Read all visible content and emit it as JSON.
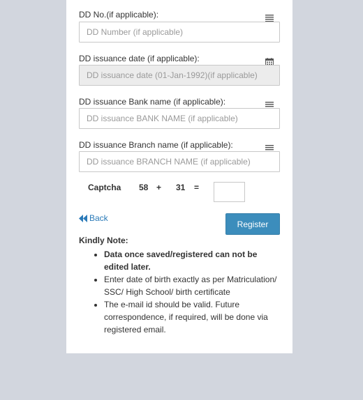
{
  "form": {
    "dd_no": {
      "label": "DD No.(if applicable):",
      "placeholder": "DD Number (if applicable)",
      "icon": "list-icon"
    },
    "dd_date": {
      "label": "DD issuance date (if applicable):",
      "placeholder": "DD issuance date (01-Jan-1992)(if applicable)",
      "icon": "calendar-icon"
    },
    "dd_bank": {
      "label": "DD issuance Bank name (if applicable):",
      "placeholder": "DD issuance BANK NAME (if applicable)",
      "icon": "list-icon"
    },
    "dd_branch": {
      "label": "DD issuance Branch name (if applicable):",
      "placeholder": "DD issuance BRANCH NAME (if applicable)",
      "icon": "list-icon"
    }
  },
  "captcha": {
    "label": "Captcha",
    "num1": "58",
    "op": "+",
    "num2": "31",
    "eq": "="
  },
  "actions": {
    "back_label": "Back",
    "register_label": "Register"
  },
  "note": {
    "title": "Kindly Note:",
    "items": [
      "Data once saved/registered can not be edited later.",
      "Enter date of birth exactly as per Matriculation/ SSC/ High School/ birth certificate",
      "The e-mail id should be valid. Future correspondence, if required, will be done via registered email."
    ]
  },
  "colors": {
    "page_bg": "#d2d6de",
    "primary": "#3c8dbc",
    "link": "#2a7ab8"
  }
}
